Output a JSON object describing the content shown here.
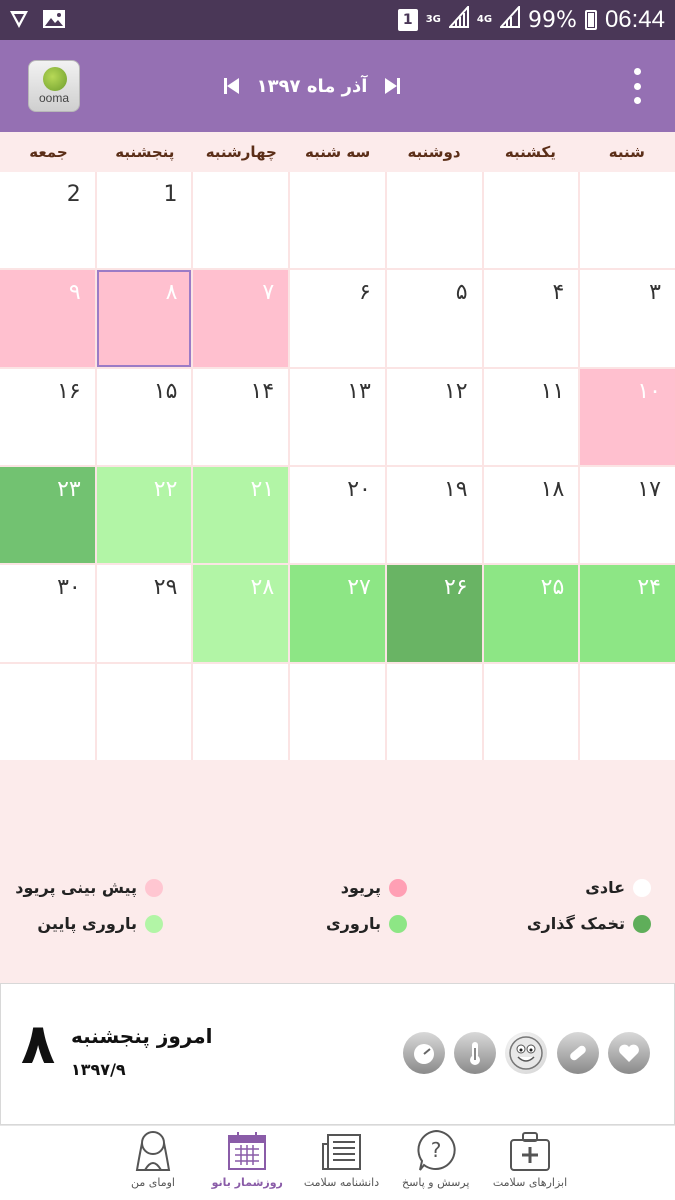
{
  "status_bar": {
    "sim_slot": "1",
    "network_1": "3G",
    "network_2": "4G",
    "battery": "99%",
    "time": "06:44",
    "icons": [
      "vpn-icon",
      "gallery-icon",
      "signal-icon",
      "battery-icon"
    ]
  },
  "header": {
    "brand": "ooma",
    "month_title": "آذر ماه ۱۳۹۷",
    "prev_icon": "skip-previous-icon",
    "next_icon": "skip-next-icon",
    "menu_icon": "overflow-menu-icon"
  },
  "weekdays": [
    "شنبه",
    "یکشنبه",
    "دوشنبه",
    "سه شنبه",
    "چهارشنبه",
    "پنجشنبه",
    "جمعه"
  ],
  "calendar": {
    "cells": [
      {
        "label": "",
        "type": "normal"
      },
      {
        "label": "",
        "type": "normal"
      },
      {
        "label": "",
        "type": "normal"
      },
      {
        "label": "",
        "type": "normal"
      },
      {
        "label": "",
        "type": "normal"
      },
      {
        "label": "1",
        "type": "normal"
      },
      {
        "label": "2",
        "type": "normal"
      },
      {
        "label": "۳",
        "type": "normal"
      },
      {
        "label": "۴",
        "type": "normal"
      },
      {
        "label": "۵",
        "type": "normal"
      },
      {
        "label": "۶",
        "type": "normal"
      },
      {
        "label": "۷",
        "type": "period"
      },
      {
        "label": "۸",
        "type": "period",
        "today": true
      },
      {
        "label": "۹",
        "type": "period"
      },
      {
        "label": "۱۰",
        "type": "period"
      },
      {
        "label": "۱۱",
        "type": "normal"
      },
      {
        "label": "۱۲",
        "type": "normal"
      },
      {
        "label": "۱۳",
        "type": "normal"
      },
      {
        "label": "۱۴",
        "type": "normal"
      },
      {
        "label": "۱۵",
        "type": "normal"
      },
      {
        "label": "۱۶",
        "type": "normal"
      },
      {
        "label": "۱۷",
        "type": "normal"
      },
      {
        "label": "۱۸",
        "type": "normal"
      },
      {
        "label": "۱۹",
        "type": "normal"
      },
      {
        "label": "۲۰",
        "type": "normal"
      },
      {
        "label": "۲۱",
        "type": "lowfert"
      },
      {
        "label": "۲۲",
        "type": "lowfert"
      },
      {
        "label": "۲۳",
        "type": "fertile-dark"
      },
      {
        "label": "۲۴",
        "type": "fertile"
      },
      {
        "label": "۲۵",
        "type": "fertile"
      },
      {
        "label": "۲۶",
        "type": "ovulation"
      },
      {
        "label": "۲۷",
        "type": "fertile"
      },
      {
        "label": "۲۸",
        "type": "lowfert"
      },
      {
        "label": "۲۹",
        "type": "normal"
      },
      {
        "label": "۳۰",
        "type": "normal"
      },
      {
        "label": "",
        "type": "normal"
      },
      {
        "label": "",
        "type": "normal"
      },
      {
        "label": "",
        "type": "normal"
      },
      {
        "label": "",
        "type": "normal"
      },
      {
        "label": "",
        "type": "normal"
      },
      {
        "label": "",
        "type": "normal"
      },
      {
        "label": "",
        "type": "normal"
      }
    ]
  },
  "legend": {
    "normal": {
      "label": "عادی",
      "color": "#ffffff"
    },
    "period": {
      "label": "پریود",
      "color": "#ff9fb4"
    },
    "predicted": {
      "label": "پیش بینی پریود",
      "color": "#ffc6d1"
    },
    "ovulation": {
      "label": "تخمک گذاری",
      "color": "#5fae5a"
    },
    "fertile": {
      "label": "باروری",
      "color": "#8de685"
    },
    "lowfert": {
      "label": "باروری پایین",
      "color": "#b2f5a6"
    }
  },
  "today": {
    "day_number": "۸",
    "label": "امروز پنجشنبه",
    "date": "۱۳۹۷/۹",
    "tools": [
      "heart-icon",
      "pill-icon",
      "mood-face-icon",
      "thermometer-icon",
      "weight-scale-icon"
    ]
  },
  "bottom_nav": [
    {
      "label": "ابزارهای سلامت",
      "icon": "medical-kit-icon"
    },
    {
      "label": "پرسش و پاسخ",
      "icon": "question-bubble-icon"
    },
    {
      "label": "دانشنامه سلامت",
      "icon": "newspaper-icon"
    },
    {
      "label": "روزشمار بانو",
      "icon": "calendar-icon",
      "active": true
    },
    {
      "label": "اومای من",
      "icon": "profile-woman-icon"
    }
  ],
  "colors": {
    "header": "#9570b3",
    "statusbar": "#4a3757",
    "background": "#fcebeb",
    "active_nav": "#8a5ca8"
  }
}
